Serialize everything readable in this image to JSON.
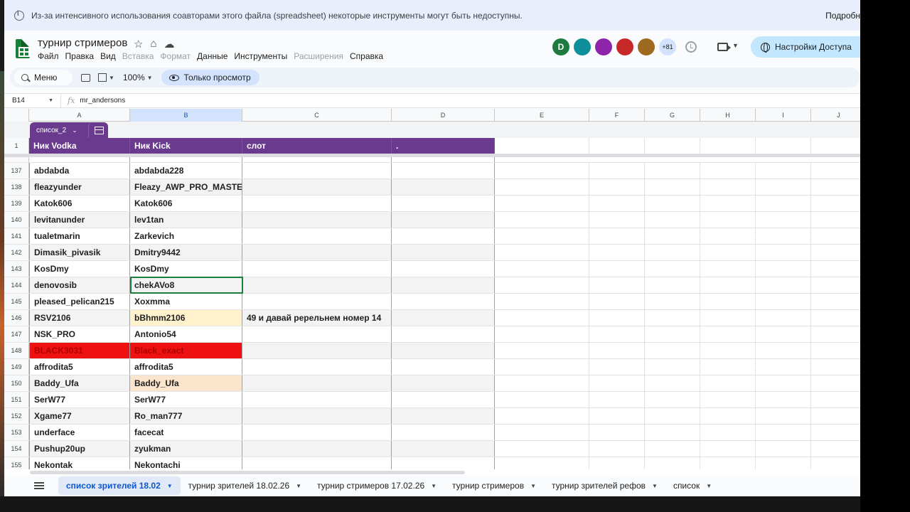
{
  "banner": {
    "text": "Из-за интенсивного использования соавторами этого файла (spreadsheet) некоторые инструменты могут быть недоступны.",
    "more_label": "Подробн"
  },
  "header": {
    "title": "турнир стримеров",
    "menu": [
      {
        "label": "Файл",
        "enabled": true
      },
      {
        "label": "Правка",
        "enabled": true
      },
      {
        "label": "Вид",
        "enabled": true
      },
      {
        "label": "Вставка",
        "enabled": false
      },
      {
        "label": "Формат",
        "enabled": false
      },
      {
        "label": "Данные",
        "enabled": true
      },
      {
        "label": "Инструменты",
        "enabled": true
      },
      {
        "label": "Расширения",
        "enabled": false
      },
      {
        "label": "Справка",
        "enabled": true
      }
    ],
    "avatars": [
      {
        "letter": "D",
        "color": "#1e7a3e"
      },
      {
        "letter": "",
        "color": "#0e8f9a"
      },
      {
        "letter": "",
        "color": "#8e24aa"
      },
      {
        "letter": "",
        "color": "#c62828"
      },
      {
        "letter": "",
        "color": "#9e6a1f"
      }
    ],
    "more_count": "+81",
    "share_label": "Настройки Доступа"
  },
  "toolbar": {
    "search_label": "Меню",
    "zoom": "100%",
    "view_only_label": "Только просмотр"
  },
  "formula_bar": {
    "cell_ref": "B14",
    "fx": "fx",
    "value": "mr_andersons"
  },
  "grid": {
    "columns": [
      "A",
      "B",
      "C",
      "D",
      "E",
      "F",
      "G",
      "H",
      "I",
      "J"
    ],
    "selected_column": "B",
    "table_name": "список_2",
    "header_row_number": "1",
    "headers": [
      "Ник Vodka",
      "Ник Kick",
      "слот",
      "."
    ],
    "rows": [
      {
        "n": "137",
        "a": "abdabda",
        "b": "abdabda228",
        "c": "",
        "d": ""
      },
      {
        "n": "138",
        "a": "fleazyunder",
        "b": "Fleazy_AWP_PRO_MASTER",
        "c": "",
        "d": ""
      },
      {
        "n": "139",
        "a": "Katok606",
        "b": "Katok606",
        "c": "",
        "d": ""
      },
      {
        "n": "140",
        "a": "levitanunder",
        "b": "lev1tan",
        "c": "",
        "d": ""
      },
      {
        "n": "141",
        "a": "tualetmarin",
        "b": "Zarkevich",
        "c": "",
        "d": ""
      },
      {
        "n": "142",
        "a": "Dimasik_pivasik",
        "b": "Dmitry9442",
        "c": "",
        "d": ""
      },
      {
        "n": "143",
        "a": "KosDmy",
        "b": "KosDmy",
        "c": "",
        "d": ""
      },
      {
        "n": "144",
        "a": "denovosib",
        "b": "chekAVo8",
        "c": "",
        "d": ""
      },
      {
        "n": "145",
        "a": "pleased_pelican215",
        "b": "Xoxmma",
        "c": "",
        "d": ""
      },
      {
        "n": "146",
        "a": "RSV2106",
        "b": "bBhmm2106",
        "c": "49 и давай ререльнем номер 14",
        "d": ""
      },
      {
        "n": "147",
        "a": "NSK_PRO",
        "b": "Antonio54",
        "c": "",
        "d": ""
      },
      {
        "n": "148",
        "a": "BLACK3031",
        "b": "Black_exact",
        "c": "",
        "d": ""
      },
      {
        "n": "149",
        "a": "affrodita5",
        "b": "affrodita5",
        "c": "",
        "d": ""
      },
      {
        "n": "150",
        "a": "Baddy_Ufa",
        "b": "Baddy_Ufa",
        "c": "",
        "d": ""
      },
      {
        "n": "151",
        "a": "SerW77",
        "b": "SerW77",
        "c": "",
        "d": ""
      },
      {
        "n": "152",
        "a": "Xgame77",
        "b": "Ro_man777",
        "c": "",
        "d": ""
      },
      {
        "n": "153",
        "a": "underface",
        "b": "facecat",
        "c": "",
        "d": ""
      },
      {
        "n": "154",
        "a": "Pushup20up",
        "b": "zyukman",
        "c": "",
        "d": ""
      },
      {
        "n": "155",
        "a": "Nekontak",
        "b": "Nekontachi",
        "c": "",
        "d": ""
      }
    ],
    "colors": {
      "header_bg": "#6a3a8e",
      "red_row_bg": "#ee1111",
      "yellow_fill": "#fff2cc",
      "peach_fill": "#fce5cd"
    }
  },
  "sheet_tabs": [
    {
      "label": "список зрителей 18.02",
      "active": true
    },
    {
      "label": "турнир зрителей 18.02.26",
      "active": false
    },
    {
      "label": "турнир стримеров 17.02.26",
      "active": false
    },
    {
      "label": "турнир стримеров",
      "active": false
    },
    {
      "label": "турнир зрителей рефов",
      "active": false
    },
    {
      "label": "список",
      "active": false
    }
  ]
}
